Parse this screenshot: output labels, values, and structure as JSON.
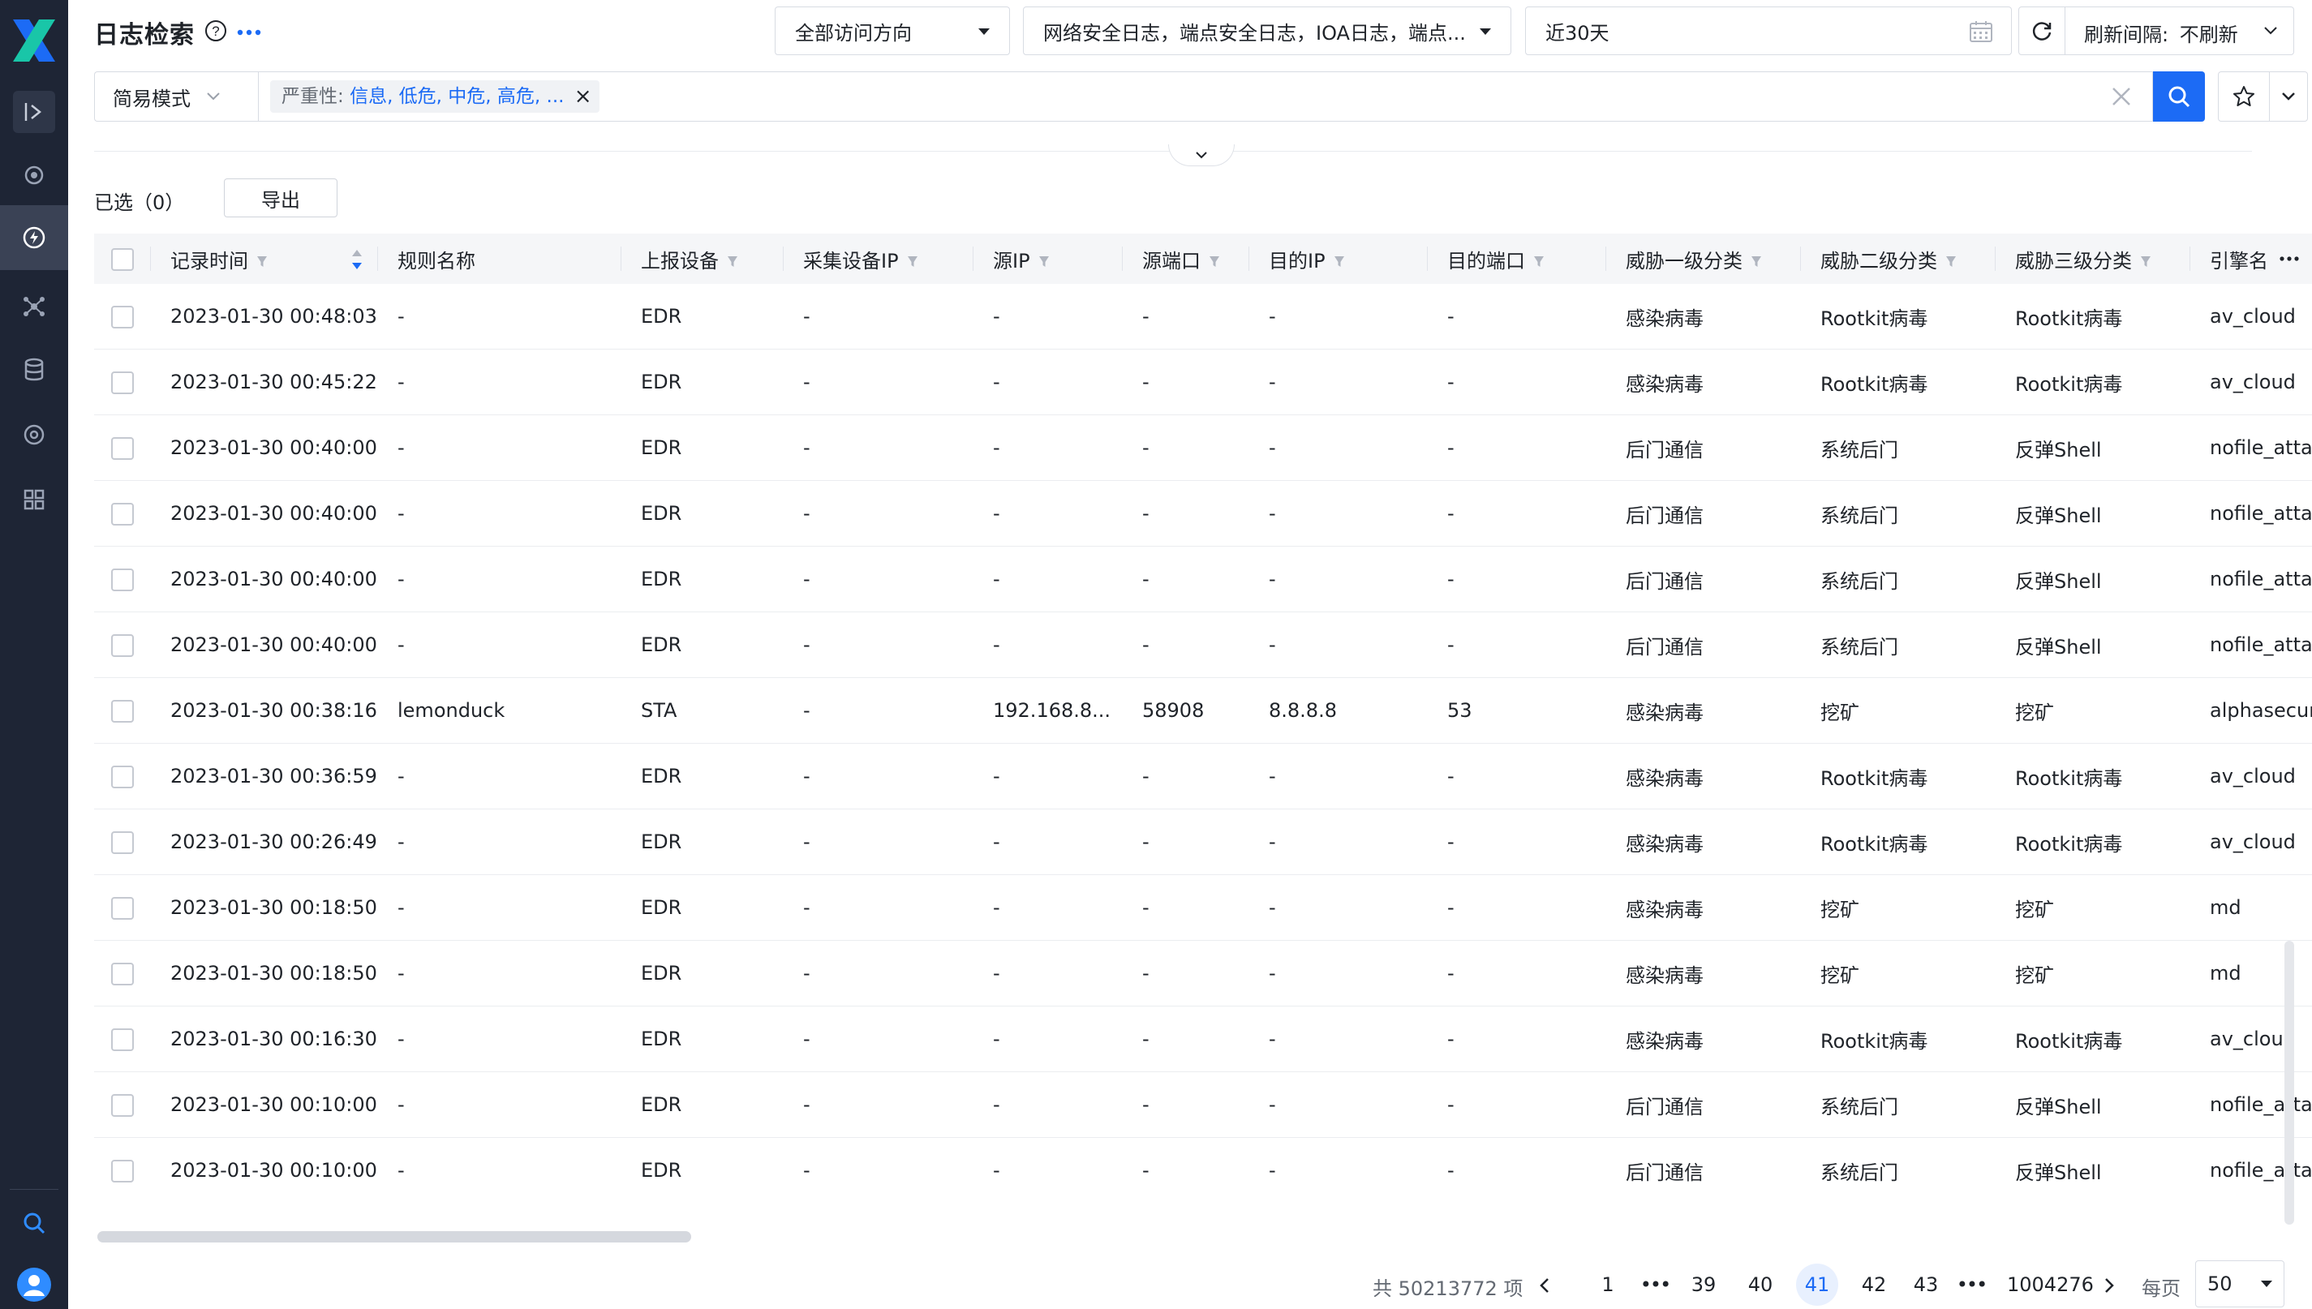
{
  "header": {
    "title": "日志检索",
    "direction_select": "全部访问方向",
    "log_types_select": "网络安全日志，端点安全日志，IOA日志，端点...",
    "date_range": "近30天",
    "refresh_label": "刷新间隔:",
    "refresh_value": "不刷新"
  },
  "search": {
    "mode": "简易模式",
    "tag_key": "严重性:",
    "tag_value": "信息, 低危, 中危, 高危, ...",
    "tag_close": "×"
  },
  "selection": {
    "label": "已选（0）",
    "export": "导出"
  },
  "table": {
    "columns": [
      "记录时间",
      "规则名称",
      "上报设备",
      "采集设备IP",
      "源IP",
      "源端口",
      "目的IP",
      "目的端口",
      "威胁一级分类",
      "威胁二级分类",
      "威胁三级分类",
      "引擎名"
    ],
    "rows": [
      [
        "2023-01-30 00:48:03",
        "-",
        "EDR",
        "-",
        "-",
        "-",
        "-",
        "-",
        "感染病毒",
        "Rootkit病毒",
        "Rootkit病毒",
        "av_cloud"
      ],
      [
        "2023-01-30 00:45:22",
        "-",
        "EDR",
        "-",
        "-",
        "-",
        "-",
        "-",
        "感染病毒",
        "Rootkit病毒",
        "Rootkit病毒",
        "av_cloud"
      ],
      [
        "2023-01-30 00:40:00",
        "-",
        "EDR",
        "-",
        "-",
        "-",
        "-",
        "-",
        "后门通信",
        "系统后门",
        "反弹Shell",
        "nofile_attack"
      ],
      [
        "2023-01-30 00:40:00",
        "-",
        "EDR",
        "-",
        "-",
        "-",
        "-",
        "-",
        "后门通信",
        "系统后门",
        "反弹Shell",
        "nofile_attack"
      ],
      [
        "2023-01-30 00:40:00",
        "-",
        "EDR",
        "-",
        "-",
        "-",
        "-",
        "-",
        "后门通信",
        "系统后门",
        "反弹Shell",
        "nofile_attack"
      ],
      [
        "2023-01-30 00:40:00",
        "-",
        "EDR",
        "-",
        "-",
        "-",
        "-",
        "-",
        "后门通信",
        "系统后门",
        "反弹Shell",
        "nofile_attack"
      ],
      [
        "2023-01-30 00:38:16",
        "lemonduck",
        "STA",
        "-",
        "192.168.8...",
        "58908",
        "8.8.8.8",
        "53",
        "感染病毒",
        "挖矿",
        "挖矿",
        "alphasecurity"
      ],
      [
        "2023-01-30 00:36:59",
        "-",
        "EDR",
        "-",
        "-",
        "-",
        "-",
        "-",
        "感染病毒",
        "Rootkit病毒",
        "Rootkit病毒",
        "av_cloud"
      ],
      [
        "2023-01-30 00:26:49",
        "-",
        "EDR",
        "-",
        "-",
        "-",
        "-",
        "-",
        "感染病毒",
        "Rootkit病毒",
        "Rootkit病毒",
        "av_cloud"
      ],
      [
        "2023-01-30 00:18:50",
        "-",
        "EDR",
        "-",
        "-",
        "-",
        "-",
        "-",
        "感染病毒",
        "挖矿",
        "挖矿",
        "md"
      ],
      [
        "2023-01-30 00:18:50",
        "-",
        "EDR",
        "-",
        "-",
        "-",
        "-",
        "-",
        "感染病毒",
        "挖矿",
        "挖矿",
        "md"
      ],
      [
        "2023-01-30 00:16:30",
        "-",
        "EDR",
        "-",
        "-",
        "-",
        "-",
        "-",
        "感染病毒",
        "Rootkit病毒",
        "Rootkit病毒",
        "av_cloud"
      ],
      [
        "2023-01-30 00:10:00",
        "-",
        "EDR",
        "-",
        "-",
        "-",
        "-",
        "-",
        "后门通信",
        "系统后门",
        "反弹Shell",
        "nofile_attack"
      ],
      [
        "2023-01-30 00:10:00",
        "-",
        "EDR",
        "-",
        "-",
        "-",
        "-",
        "-",
        "后门通信",
        "系统后门",
        "反弹Shell",
        "nofile_attack"
      ]
    ]
  },
  "pagination": {
    "total": "共 50213772 项",
    "pages": [
      "1",
      "•••",
      "39",
      "40",
      "41",
      "42",
      "43",
      "•••",
      "1004276"
    ],
    "current": "41",
    "per_page_label": "每页",
    "per_page": "50"
  },
  "colors": {
    "accent": "#1c6bf5",
    "sidebar": "#1e2535"
  }
}
